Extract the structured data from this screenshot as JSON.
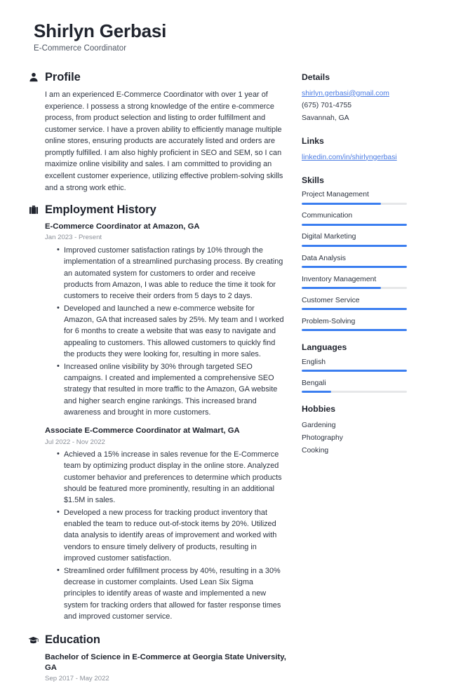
{
  "header": {
    "name": "Shirlyn Gerbasi",
    "job_title": "E-Commerce Coordinator"
  },
  "accent_color": "#3b7ef0",
  "link_color": "#4a7be3",
  "profile": {
    "icon": "person-icon",
    "title": "Profile",
    "text": "I am an experienced E-Commerce Coordinator with over 1 year of experience. I possess a strong knowledge of the entire e-commerce process, from product selection and listing to order fulfillment and customer service. I have a proven ability to efficiently manage multiple online stores, ensuring products are accurately listed and orders are promptly fulfilled. I am also highly proficient in SEO and SEM, so I can maximize online visibility and sales. I am committed to providing an excellent customer experience, utilizing effective problem-solving skills and a strong work ethic."
  },
  "employment": {
    "icon": "briefcase-icon",
    "title": "Employment History",
    "entries": [
      {
        "title": "E-Commerce Coordinator at Amazon, GA",
        "date": "Jan 2023 - Present",
        "bullets": [
          "Improved customer satisfaction ratings by 10% through the implementation of a streamlined purchasing process. By creating an automated system for customers to order and receive products from Amazon, I was able to reduce the time it took for customers to receive their orders from 5 days to 2 days.",
          "Developed and launched a new e-commerce website for Amazon, GA that increased sales by 25%. My team and I worked for 6 months to create a website that was easy to navigate and appealing to customers. This allowed customers to quickly find the products they were looking for, resulting in more sales.",
          "Increased online visibility by 30% through targeted SEO campaigns. I created and implemented a comprehensive SEO strategy that resulted in more traffic to the Amazon, GA website and higher search engine rankings. This increased brand awareness and brought in more customers."
        ]
      },
      {
        "title": "Associate E-Commerce Coordinator at Walmart, GA",
        "date": "Jul 2022 - Nov 2022",
        "bullets": [
          "Achieved a 15% increase in sales revenue for the E-Commerce team by optimizing product display in the online store. Analyzed customer behavior and preferences to determine which products should be featured more prominently, resulting in an additional $1.5M in sales.",
          "Developed a new process for tracking product inventory that enabled the team to reduce out-of-stock items by 20%. Utilized data analysis to identify areas of improvement and worked with vendors to ensure timely delivery of products, resulting in improved customer satisfaction.",
          "Streamlined order fulfillment process by 40%, resulting in a 30% decrease in customer complaints. Used Lean Six Sigma principles to identify areas of waste and implemented a new system for tracking orders that allowed for faster response times and improved customer service."
        ]
      }
    ]
  },
  "education": {
    "icon": "graduation-cap-icon",
    "title": "Education",
    "entries": [
      {
        "title": "Bachelor of Science in E-Commerce at Georgia State University, GA",
        "date": "Sep 2017 - May 2022"
      }
    ]
  },
  "details": {
    "title": "Details",
    "email": "shirlyn.gerbasi@gmail.com",
    "phone": "(675) 701-4755",
    "location": "Savannah, GA"
  },
  "links": {
    "title": "Links",
    "items": [
      {
        "label": "linkedin.com/in/shirlyngerbasi"
      }
    ]
  },
  "skills": {
    "title": "Skills",
    "items": [
      {
        "label": "Project Management",
        "level": 75
      },
      {
        "label": "Communication",
        "level": 100
      },
      {
        "label": "Digital Marketing",
        "level": 100
      },
      {
        "label": "Data Analysis",
        "level": 100
      },
      {
        "label": "Inventory Management",
        "level": 75
      },
      {
        "label": "Customer Service",
        "level": 100
      },
      {
        "label": "Problem-Solving",
        "level": 100
      }
    ]
  },
  "languages": {
    "title": "Languages",
    "items": [
      {
        "label": "English",
        "level": 100
      },
      {
        "label": "Bengali",
        "level": 28
      }
    ]
  },
  "hobbies": {
    "title": "Hobbies",
    "items": [
      {
        "label": "Gardening"
      },
      {
        "label": "Photography"
      },
      {
        "label": "Cooking"
      }
    ]
  }
}
